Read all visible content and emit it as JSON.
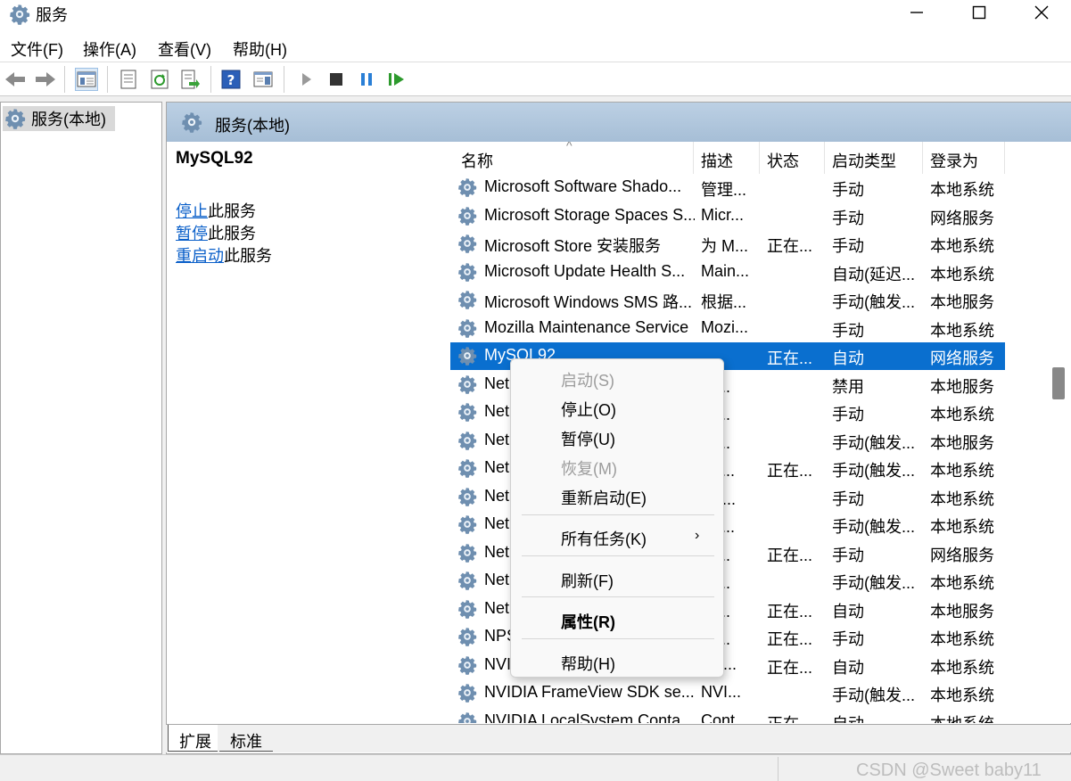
{
  "window": {
    "title": "服务"
  },
  "menubar": [
    "文件(F)",
    "操作(A)",
    "查看(V)",
    "帮助(H)"
  ],
  "tree": {
    "root_label": "服务(本地)"
  },
  "panel": {
    "header": "服务(本地)"
  },
  "extended": {
    "service_name": "MySQL92",
    "actions": [
      {
        "link": "停止",
        "suffix": "此服务"
      },
      {
        "link": "暂停",
        "suffix": "此服务"
      },
      {
        "link": "重启动",
        "suffix": "此服务"
      }
    ]
  },
  "list": {
    "sort_indicator": "^",
    "columns": [
      "名称",
      "描述",
      "状态",
      "启动类型",
      "登录为"
    ],
    "rows": [
      [
        "Microsoft Software Shado...",
        "管理...",
        "",
        "手动",
        "本地系统"
      ],
      [
        "Microsoft Storage Spaces S...",
        "Micr...",
        "",
        "手动",
        "网络服务"
      ],
      [
        "Microsoft Store 安装服务",
        "为 M...",
        "正在...",
        "手动",
        "本地系统"
      ],
      [
        "Microsoft Update Health S...",
        "Main...",
        "",
        "自动(延迟...",
        "本地系统"
      ],
      [
        "Microsoft Windows SMS 路...",
        "根据...",
        "",
        "手动(触发...",
        "本地服务"
      ],
      [
        "Mozilla Maintenance Service",
        "Mozi...",
        "",
        "手动",
        "本地系统"
      ],
      [
        "MySQL92",
        "",
        "正在...",
        "自动",
        "网络服务"
      ],
      [
        "Net",
        "共...",
        "",
        "禁用",
        "本地服务"
      ],
      [
        "Net",
        "用...",
        "",
        "手动",
        "本地系统"
      ],
      [
        "Net",
        "络...",
        "",
        "手动(触发...",
        "本地服务"
      ],
      [
        "Net",
        "于 ...",
        "正在...",
        "手动(触发...",
        "本地系统"
      ],
      [
        "Net",
        "理“...",
        "",
        "手动",
        "本地系统"
      ],
      [
        "Net",
        "共 ...",
        "",
        "手动(触发...",
        "本地系统"
      ],
      [
        "Net",
        "别...",
        "正在...",
        "手动",
        "网络服务"
      ],
      [
        "Net",
        "络...",
        "",
        "手动(触发...",
        "本地系统"
      ],
      [
        "Net",
        "报...",
        "正在...",
        "自动",
        "本地服务"
      ],
      [
        "NPS",
        "务...",
        "正在...",
        "手动",
        "本地系统"
      ],
      [
        "NVI",
        "ont...",
        "正在...",
        "自动",
        "本地系统"
      ],
      [
        "NVIDIA FrameView SDK se...",
        "NVI...",
        "",
        "手动(触发...",
        "本地系统"
      ],
      [
        "NVIDIA LocalSystem Conta...",
        "Cont...",
        "正在...",
        "自动",
        "本地系统"
      ]
    ],
    "selected_index": 6
  },
  "context_menu": {
    "items": [
      {
        "label": "启动(S)",
        "disabled": true
      },
      {
        "label": "停止(O)"
      },
      {
        "label": "暂停(U)"
      },
      {
        "label": "恢复(M)",
        "disabled": true
      },
      {
        "label": "重新启动(E)"
      },
      {
        "label": "所有任务(K)",
        "submenu": true
      },
      {
        "label": "刷新(F)"
      },
      {
        "label": "属性(R)",
        "bold": true
      },
      {
        "label": "帮助(H)"
      }
    ],
    "submenu_arrow": "›"
  },
  "tabs": [
    "扩展",
    "标准"
  ],
  "watermark": "CSDN @Sweet baby11",
  "colors": {
    "selection": "#0a6fcf",
    "link": "#0a5fc9",
    "header": "#a6bed6"
  }
}
